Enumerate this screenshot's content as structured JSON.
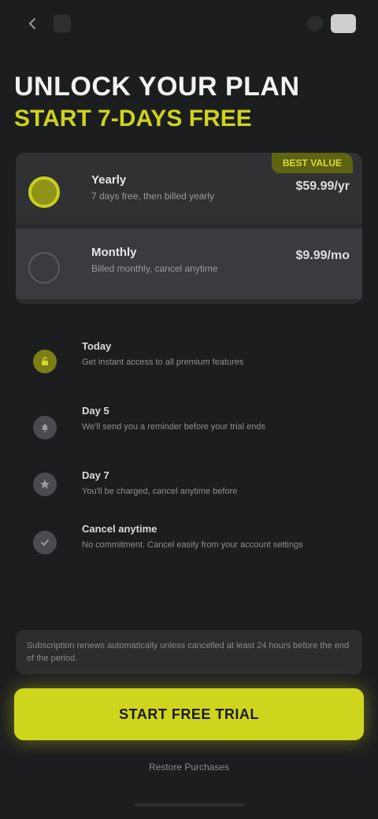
{
  "topbar": {
    "back_icon": "back-arrow-icon",
    "logo_text": "",
    "right_pill": "",
    "menu_icon": "menu-icon"
  },
  "header": {
    "title": "UNLOCK YOUR PLAN",
    "subtitle": "START 7-DAYS FREE"
  },
  "plans": {
    "badge": "BEST VALUE",
    "items": [
      {
        "name": "Yearly",
        "desc": "7 days free, then billed yearly",
        "price": "$59.99/yr",
        "selected": true
      },
      {
        "name": "Monthly",
        "desc": "Billed monthly, cancel anytime",
        "price": "$9.99/mo",
        "selected": false
      }
    ]
  },
  "features": [
    {
      "title": "Today",
      "desc": "Get instant access to all premium features",
      "icon": "lock-open-icon",
      "active": true
    },
    {
      "title": "Day 5",
      "desc": "We'll send you a reminder before your trial ends",
      "icon": "bell-icon",
      "active": false
    },
    {
      "title": "Day 7",
      "desc": "You'll be charged, cancel anytime before",
      "icon": "star-icon",
      "active": false
    },
    {
      "title": "Cancel anytime",
      "desc": "No commitment. Cancel easily from your account settings",
      "icon": "check-icon",
      "active": false
    }
  ],
  "notice": "Subscription renews automatically unless cancelled at least 24 hours before the end of the period.",
  "cta_label": "Start Free Trial",
  "restore_label": "Restore Purchases",
  "colors": {
    "accent": "#cfd51d",
    "background": "#1c1d1f",
    "card": "#2a2b2d"
  }
}
